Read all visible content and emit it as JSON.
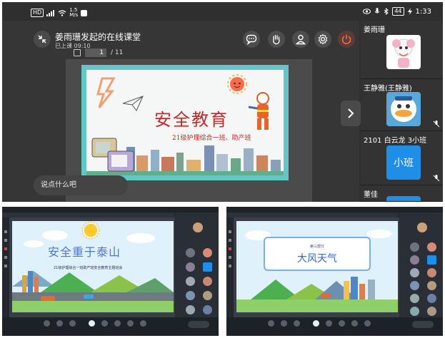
{
  "mobile": {
    "status": {
      "left_icons": [
        "hd-badge",
        "sim-icon",
        "signal-icon",
        "wifi-icon"
      ],
      "speed_value": "1.5",
      "speed_unit": "M/s",
      "battery": "44",
      "time": "1:33"
    },
    "header": {
      "title": "姜雨珊发起的在线课堂",
      "status": "已上课 09:10"
    },
    "pager": {
      "current": "1",
      "total": "/ 11"
    },
    "slide": {
      "title": "安全教育",
      "subtitle": "21级护理综合一班、助产班"
    },
    "chat_placeholder": "说点什么吧",
    "participants": [
      {
        "name": "姜雨珊",
        "avatar": "sheep-avatar"
      },
      {
        "name": "王静雅(王静雅)",
        "avatar": "donald-duck-avatar"
      },
      {
        "name": "2101 白云龙 3小班",
        "avatar_text": "小班"
      },
      {
        "name": "董佳"
      }
    ]
  },
  "desktop_left": {
    "slide_title": "安全重于泰山",
    "slide_subtitle": "21级护理综合一班助产班安全教育主题班会"
  },
  "desktop_right": {
    "part_label": "第三部分",
    "slide_title": "大风天气"
  },
  "colors": {
    "accent_red": "#c62828",
    "slide_teal": "#63c7c7",
    "avatar_blue": "#1e8ee9",
    "leave_red": "#ff6a3d"
  }
}
